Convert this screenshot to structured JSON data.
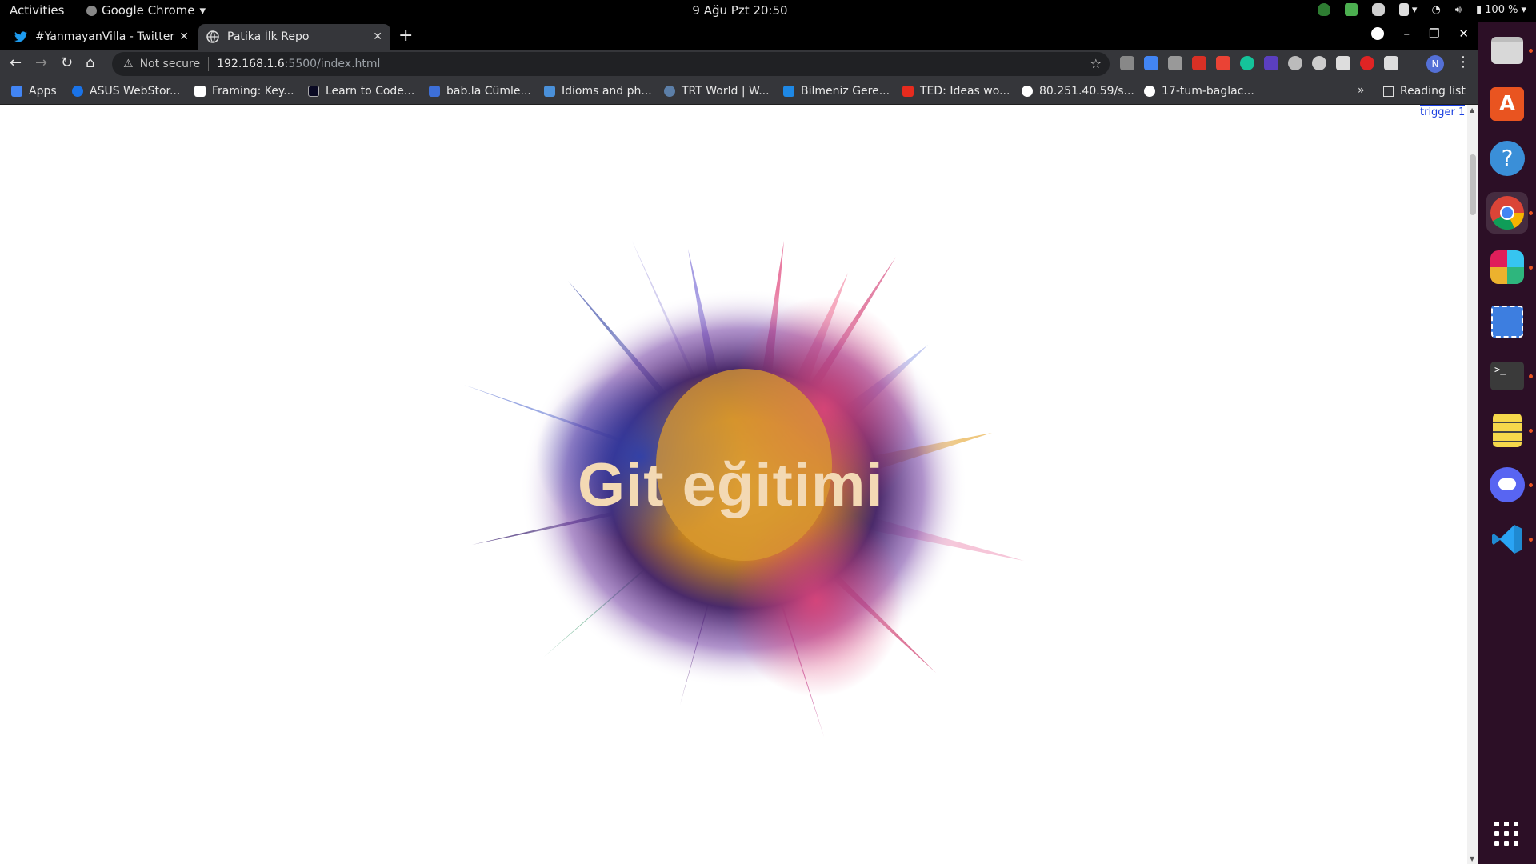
{
  "topbar": {
    "activities": "Activities",
    "app_name": "Google Chrome",
    "datetime": "9 Ağu Pzt  20:50",
    "battery": "100 %"
  },
  "tabs": [
    {
      "title": "#YanmayanVilla - Twitter",
      "icon": "twitter-icon",
      "active": false
    },
    {
      "title": "Patika İlk Repo",
      "icon": "globe-icon",
      "active": true
    }
  ],
  "address_bar": {
    "security_label": "Not secure",
    "host": "192.168.1.6",
    "path": ":5500/index.html"
  },
  "bookmarks": [
    {
      "label": "Apps",
      "icon": "apps-grid-icon",
      "color": "#4285f4"
    },
    {
      "label": "ASUS WebStor...",
      "icon": "asus-icon",
      "color": "#1a73e8"
    },
    {
      "label": "Framing: Key...",
      "icon": "framing-icon",
      "color": "#ffffff"
    },
    {
      "label": "Learn to Code...",
      "icon": "freecodecamp-icon",
      "color": "#0a0a23"
    },
    {
      "label": "bab.la Cümle...",
      "icon": "babla-icon",
      "color": "#3d6fd8"
    },
    {
      "label": "Idioms and ph...",
      "icon": "idioms-icon",
      "color": "#4a90d9"
    },
    {
      "label": "TRT World | W...",
      "icon": "trt-icon",
      "color": "#5c7fa8"
    },
    {
      "label": "Bilmeniz Gere...",
      "icon": "bilmeniz-icon",
      "color": "#1e88e5"
    },
    {
      "label": "TED: Ideas wo...",
      "icon": "ted-icon",
      "color": "#e62b1e"
    },
    {
      "label": "80.251.40.59/s...",
      "icon": "globe-icon",
      "color": "#ffffff"
    },
    {
      "label": "17-tum-baglac...",
      "icon": "globe-icon",
      "color": "#ffffff"
    }
  ],
  "reading_list": "Reading list",
  "page": {
    "trigger_label": "trigger 1",
    "hero_title": "Git eğitimi"
  },
  "dock": [
    {
      "name": "files",
      "icon": "files-icon",
      "running": true
    },
    {
      "name": "software",
      "icon": "ubuntu-software-icon",
      "running": false
    },
    {
      "name": "help",
      "icon": "help-icon",
      "running": false
    },
    {
      "name": "chrome",
      "icon": "chrome-icon",
      "running": true
    },
    {
      "name": "slack",
      "icon": "slack-icon",
      "running": true
    },
    {
      "name": "screenshot",
      "icon": "screenshot-icon",
      "running": false
    },
    {
      "name": "terminal",
      "icon": "terminal-icon",
      "running": true
    },
    {
      "name": "notes",
      "icon": "notes-icon",
      "running": true
    },
    {
      "name": "discord",
      "icon": "discord-icon",
      "running": true
    },
    {
      "name": "vscode",
      "icon": "vscode-icon",
      "running": true
    }
  ]
}
